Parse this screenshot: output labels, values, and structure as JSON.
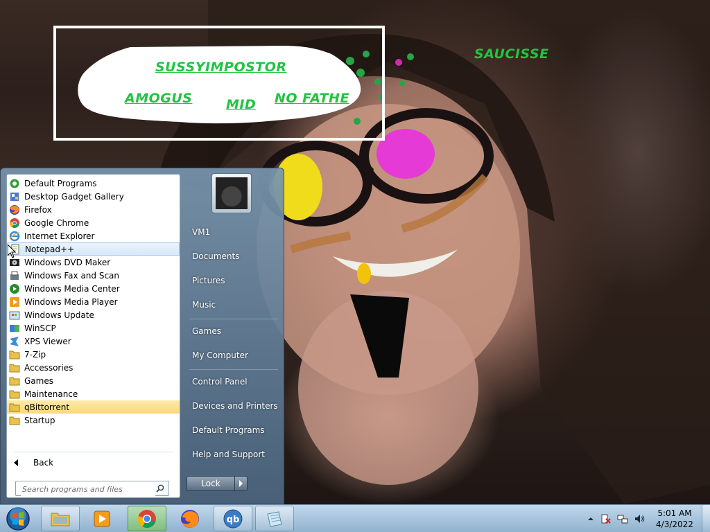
{
  "wallpaper": {
    "meme_texts": [
      "SUSSYIMPOSTOR",
      "AMOGUS",
      "MID",
      "NO FATHE",
      "SAUCISSE"
    ],
    "text_color": "#21c442"
  },
  "start_menu": {
    "programs": [
      {
        "label": "Default Programs",
        "icon": "default-programs-icon"
      },
      {
        "label": "Desktop Gadget Gallery",
        "icon": "gadget-gallery-icon"
      },
      {
        "label": "Firefox",
        "icon": "firefox-icon"
      },
      {
        "label": "Google Chrome",
        "icon": "chrome-icon"
      },
      {
        "label": "Internet Explorer",
        "icon": "internet-explorer-icon"
      },
      {
        "label": "Notepad++",
        "icon": "notepad-plus-plus-icon",
        "state": "hover"
      },
      {
        "label": "Windows DVD Maker",
        "icon": "dvd-maker-icon"
      },
      {
        "label": "Windows Fax and Scan",
        "icon": "fax-scan-icon"
      },
      {
        "label": "Windows Media Center",
        "icon": "media-center-icon"
      },
      {
        "label": "Windows Media Player",
        "icon": "media-player-icon"
      },
      {
        "label": "Windows Update",
        "icon": "windows-update-icon"
      },
      {
        "label": "WinSCP",
        "icon": "winscp-icon"
      },
      {
        "label": "XPS Viewer",
        "icon": "xps-viewer-icon"
      },
      {
        "label": "7-Zip",
        "icon": "folder-icon"
      },
      {
        "label": "Accessories",
        "icon": "folder-icon"
      },
      {
        "label": "Games",
        "icon": "folder-icon"
      },
      {
        "label": "Maintenance",
        "icon": "folder-icon"
      },
      {
        "label": "qBittorrent",
        "icon": "folder-icon",
        "state": "selected"
      },
      {
        "label": "Startup",
        "icon": "folder-icon"
      }
    ],
    "back_label": "Back",
    "search_placeholder": "Search programs and files",
    "right_items": [
      "VM1",
      "Documents",
      "Pictures",
      "Music",
      "Games",
      "My Computer",
      "Control Panel",
      "Devices and Printers",
      "Default Programs",
      "Help and Support"
    ],
    "lock_label": "Lock"
  },
  "taskbar": {
    "buttons": [
      "explorer-icon",
      "media-player-icon",
      "chrome-icon",
      "firefox-icon",
      "qbittorrent-icon",
      "notepad-icon"
    ],
    "active_button": "chrome-icon",
    "clock_time": "5:01 AM",
    "clock_date": "4/3/2022"
  }
}
